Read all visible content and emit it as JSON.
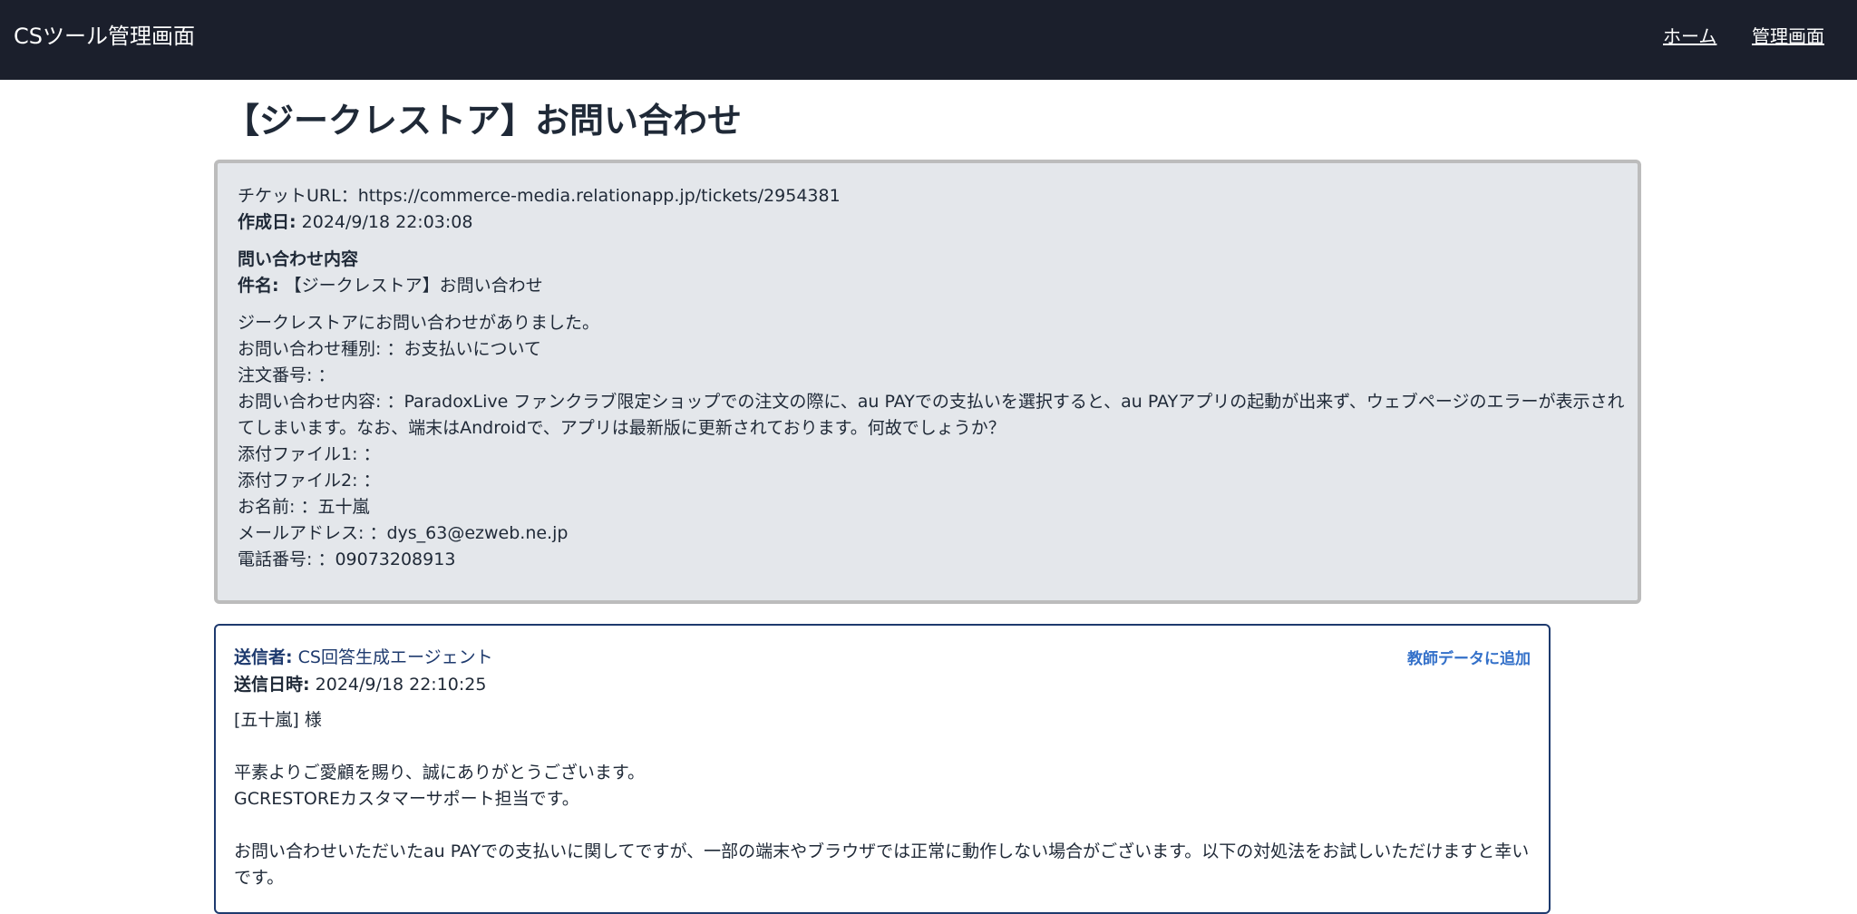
{
  "header": {
    "brand": "CSツール管理画面",
    "nav": {
      "home": "ホーム",
      "admin": "管理画面"
    }
  },
  "page": {
    "title": "【ジークレストア】お問い合わせ"
  },
  "ticket": {
    "url_line": "チケットURL：https://commerce-media.relationapp.jp/tickets/2954381",
    "created_label": "作成日:",
    "created_value": "2024/9/18 22:03:08",
    "section_heading": "問い合わせ内容",
    "subject_label": "件名:",
    "subject_value": "【ジークレストア】お問い合わせ",
    "body": {
      "line1": "ジークレストアにお問い合わせがありました。",
      "line2": "お問い合わせ種別: ：お支払いについて",
      "line3": "注文番号: ：",
      "line4": "お問い合わせ内容: ：ParadoxLive ファンクラブ限定ショップでの注文の際に、au PAYでの支払いを選択すると、au PAYアプリの起動が出来ず、ウェブページのエラーが表示されてしまいます。なお、端末はAndroidで、アプリは最新版に更新されております。何故でしょうか？",
      "line5": "添付ファイル1: ：",
      "line6": "添付ファイル2: ：",
      "line7": "お名前: ：五十嵐",
      "line8": "メールアドレス: ：dys_63@ezweb.ne.jp",
      "line9": "電話番号: ：09073208913"
    }
  },
  "message": {
    "sender_label": "送信者:",
    "sender_value": "CS回答生成エージェント",
    "sent_label": "送信日時:",
    "sent_value": "2024/9/18 22:10:25",
    "add_teacher_label": "教師データに追加",
    "body": {
      "greeting": "[五十嵐] 様",
      "line1": "平素よりご愛顧を賜り、誠にありがとうございます。",
      "line2": "GCRESTOREカスタマーサポート担当です。",
      "line3": "お問い合わせいただいたau PAYでの支払いに関してですが、一部の端末やブラウザでは正常に動作しない場合がございます。以下の対処法をお試しいただけますと幸いです。"
    }
  }
}
